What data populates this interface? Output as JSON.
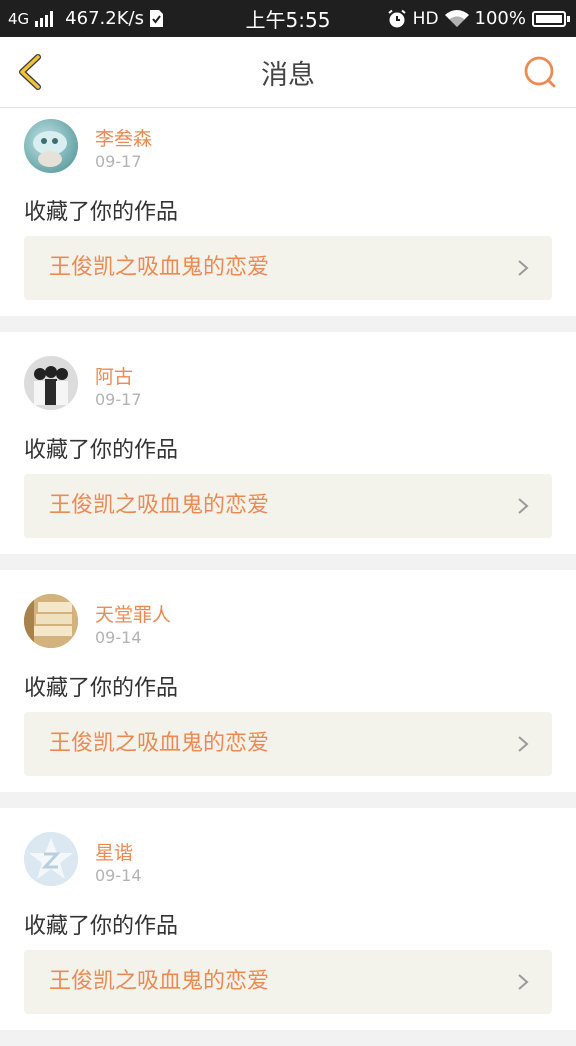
{
  "status_bar": {
    "network": "4G",
    "speed": "467.2K/s",
    "time": "上午5:55",
    "hd": "HD",
    "battery": "100%"
  },
  "header": {
    "title": "消息",
    "back_icon": "chevron-left-icon",
    "search_icon": "search-icon"
  },
  "colors": {
    "accent": "#ec8a53",
    "back_icon": "#f2c23b",
    "card_bg": "#f3f3ec",
    "page_bg": "#f2f2f2"
  },
  "messages": [
    {
      "user": "李叁森",
      "date": "09-17",
      "action": "收藏了你的作品",
      "work": "王俊凯之吸血鬼的恋爱"
    },
    {
      "user": "阿古",
      "date": "09-17",
      "action": "收藏了你的作品",
      "work": "王俊凯之吸血鬼的恋爱"
    },
    {
      "user": "天堂罪人",
      "date": "09-14",
      "action": "收藏了你的作品",
      "work": "王俊凯之吸血鬼的恋爱"
    },
    {
      "user": "星谐",
      "date": "09-14",
      "action": "收藏了你的作品",
      "work": "王俊凯之吸血鬼的恋爱"
    }
  ]
}
